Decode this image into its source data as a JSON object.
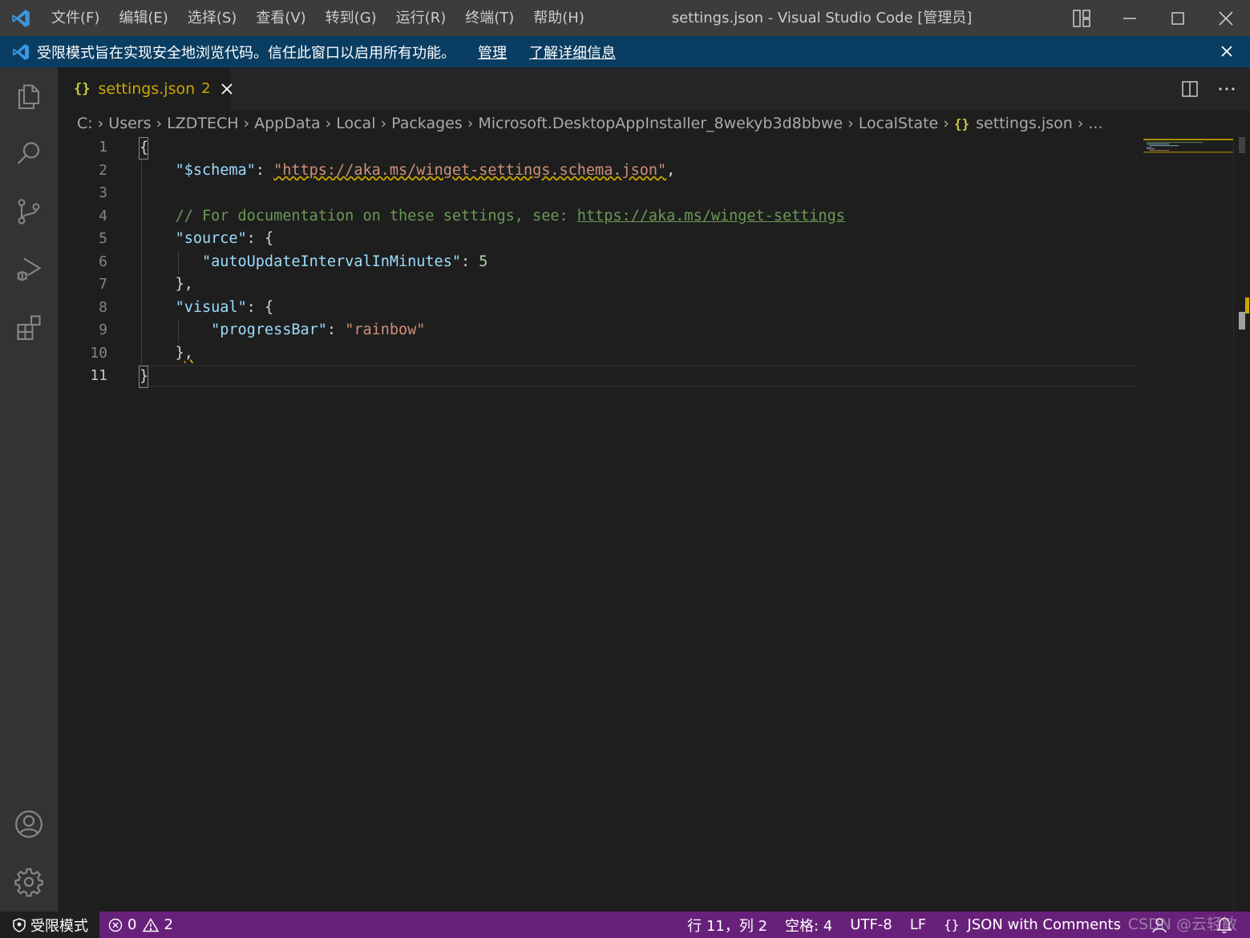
{
  "titlebar": {
    "menu": [
      "文件(F)",
      "编辑(E)",
      "选择(S)",
      "查看(V)",
      "转到(G)",
      "运行(R)",
      "终端(T)",
      "帮助(H)"
    ],
    "window_title": "settings.json - Visual Studio Code [管理员]"
  },
  "banner": {
    "text": "受限模式旨在实现安全地浏览代码。信任此窗口以启用所有功能。",
    "manage_link": "管理",
    "learn_more_link": "了解详细信息"
  },
  "activity_bar": {
    "icons": [
      "explorer-icon",
      "search-icon",
      "source-control-icon",
      "run-debug-icon",
      "extensions-icon",
      "accounts-icon",
      "settings-gear-icon"
    ]
  },
  "tab": {
    "icon": "{}",
    "label": "settings.json",
    "problem_count": "2"
  },
  "breadcrumb": {
    "segments": [
      "C:",
      "Users",
      "LZDTECH",
      "AppData",
      "Local",
      "Packages",
      "Microsoft.DesktopAppInstaller_8wekyb3d8bbwe",
      "LocalState"
    ],
    "file_icon": "{}",
    "file": "settings.json",
    "more": "..."
  },
  "editor": {
    "line_numbers": [
      "1",
      "2",
      "3",
      "4",
      "5",
      "6",
      "7",
      "8",
      "9",
      "10",
      "11"
    ],
    "active_line": "11",
    "code": {
      "l1": "{",
      "l2_key": "\"$schema\"",
      "l2_colon": ": ",
      "l2_value": "\"https://aka.ms/winget-settings.schema.json\"",
      "l2_comma": ",",
      "l4_comment": "// For documentation on these settings, see: ",
      "l4_link": "https://aka.ms/winget-settings",
      "l5_key": "\"source\"",
      "l5_rest": ": {",
      "l6_key": "\"autoUpdateIntervalInMinutes\"",
      "l6_colon": ": ",
      "l6_value": "5",
      "l7": "},",
      "l8_key": "\"visual\"",
      "l8_rest": ": {",
      "l9_key": "\"progressBar\"",
      "l9_colon": ": ",
      "l9_value": "\"rainbow\"",
      "l10_brace": "}",
      "l10_comma": ",",
      "l11": "}"
    }
  },
  "statusbar": {
    "restricted_mode": "受限模式",
    "errors": "0",
    "warnings": "2",
    "position": "行 11，列 2",
    "spaces": "空格: 4",
    "encoding": "UTF-8",
    "eol": "LF",
    "language_icon": "{}",
    "language": "JSON with Comments"
  },
  "watermark": "CSDN @云轻敏",
  "colors": {
    "titlebar": "#3c3c3c",
    "banner": "#0a3d62",
    "statusbar": "#68217a",
    "editor_bg": "#1e1e1e",
    "tab_modified": "#cca700"
  }
}
